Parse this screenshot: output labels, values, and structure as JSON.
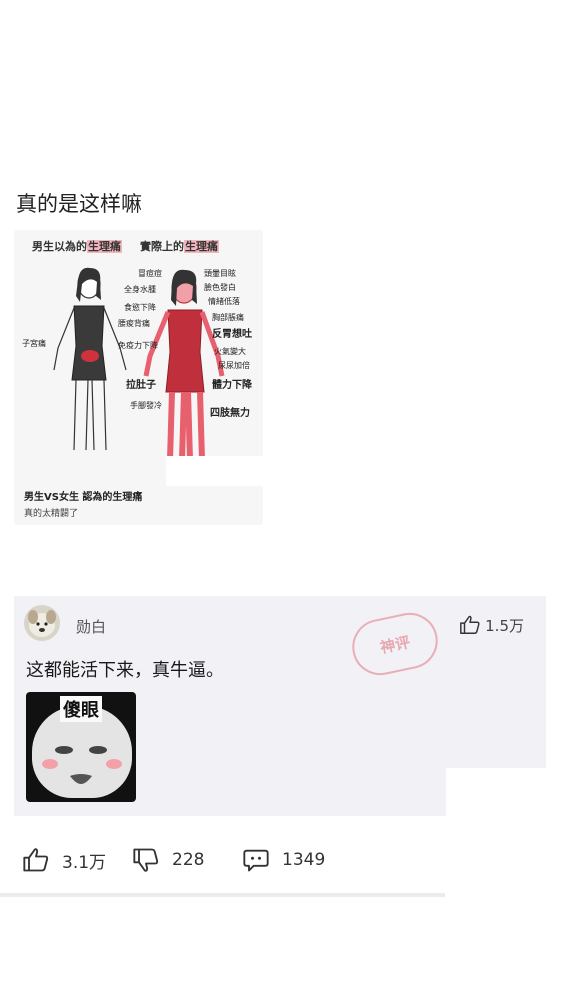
{
  "post": {
    "title": "真的是这样嘛"
  },
  "image": {
    "header_left_prefix": "男生以為的",
    "header_left_hl": "生理痛",
    "header_right_prefix": "實際上的",
    "header_right_hl": "生理痛",
    "left_labels": [
      "子宮痛"
    ],
    "right_labels": [
      "冒痘痘",
      "頭暈目眩",
      "全身水腫",
      "臉色發白",
      "食慾下降",
      "情緒低落",
      "腰痠背痛",
      "胸部脹痛",
      "反胃想吐",
      "免疫力下降",
      "火氣變大",
      "尿尿加倍",
      "拉肚子",
      "體力下降",
      "手腳發冷",
      "四肢無力"
    ],
    "caption": "男生VS女生 認為的生理痛",
    "sub_caption": "真的太精闢了"
  },
  "comment": {
    "username": "勋白",
    "likes": "1.5万",
    "text": "这都能活下来，真牛逼。",
    "stamp": "神评",
    "meme_caption": "傻眼"
  },
  "actions": {
    "like_count": "3.1万",
    "dislike_count": "228",
    "comment_count": "1349"
  },
  "colors": {
    "accent_pink": "#f3b6bf",
    "card_bg": "#f2f1f6",
    "figure_red": "#e8606e",
    "figure_dark": "#333333"
  }
}
